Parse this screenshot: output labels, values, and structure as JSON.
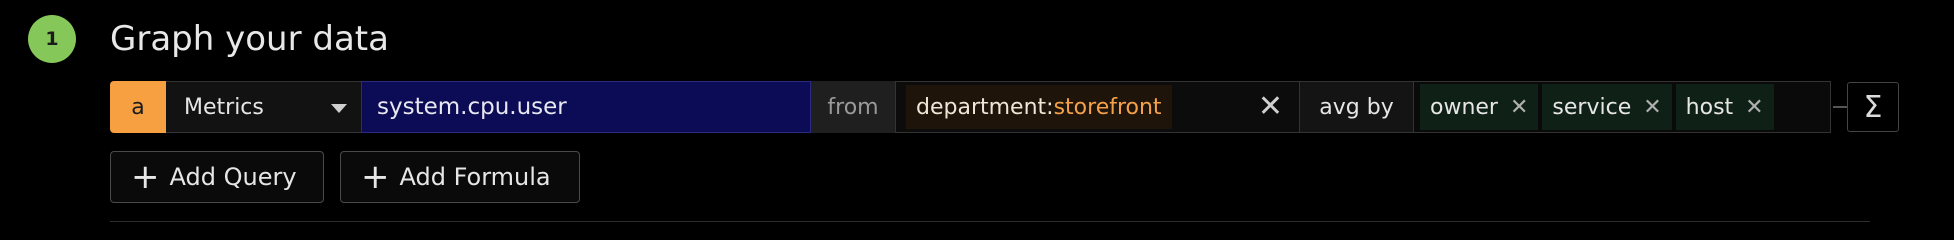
{
  "step": {
    "number": "1",
    "title": "Graph your data"
  },
  "query": {
    "letter": "a",
    "source": "Metrics",
    "metric": "system.cpu.user",
    "from_label": "from",
    "filter": {
      "key": "department:",
      "value": "storefront"
    },
    "avg_label": "avg by",
    "group_by": [
      "owner",
      "service",
      "host"
    ],
    "sigma_label": "Σ"
  },
  "buttons": {
    "add_query": "Add Query",
    "add_formula": "Add Formula"
  },
  "colors": {
    "step": "#86c75a",
    "query_letter": "#f7a041",
    "metric_bg": "#0b0b56",
    "filter_value": "#f5a14a"
  }
}
